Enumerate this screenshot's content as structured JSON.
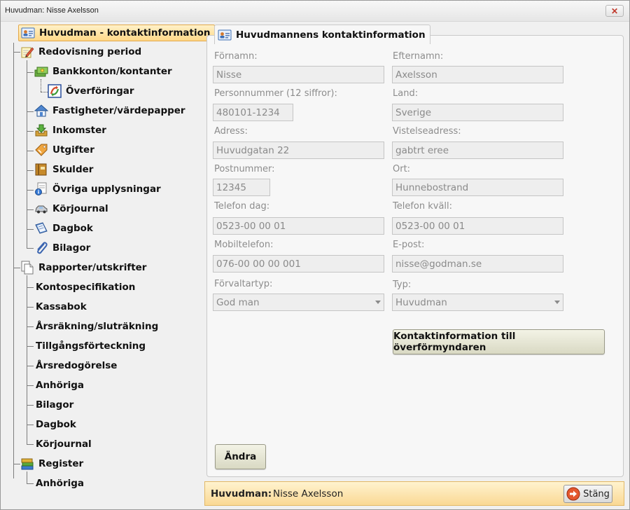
{
  "window": {
    "title": "Huvudman: Nisse Axelsson",
    "close_glyph": "✕"
  },
  "tree": {
    "main": "Huvudman - kontaktinformation",
    "period": "Redovisning period",
    "bank": "Bankkonton/kontanter",
    "transfers": "Överföringar",
    "property": "Fastigheter/värdepapper",
    "income": "Inkomster",
    "expenses": "Utgifter",
    "debts": "Skulder",
    "other_info": "Övriga upplysningar",
    "driving_log": "Körjournal",
    "diary": "Dagbok",
    "attachments": "Bilagor",
    "reports": "Rapporter/utskrifter",
    "reports_items": [
      "Kontospecifikation",
      "Kassabok",
      "Årsräkning/sluträkning",
      "Tillgångsförteckning",
      "Årsredogörelse",
      "Anhöriga",
      "Bilagor",
      "Dagbok",
      "Körjournal"
    ],
    "register": "Register",
    "register_items": [
      "Anhöriga"
    ]
  },
  "panel": {
    "title": "Huvudmannens kontaktinformation",
    "labels": {
      "first_name": "Förnamn:",
      "last_name": "Efternamn:",
      "ssn": "Personnummer (12 siffror):",
      "country": "Land:",
      "address": "Adress:",
      "stay_address": "Vistelseadress:",
      "postcode": "Postnummer:",
      "city": "Ort:",
      "phone_day": "Telefon dag:",
      "phone_evening": "Telefon kväll:",
      "mobile": "Mobiltelefon:",
      "email": "E-post:",
      "admin_type": "Förvaltartyp:",
      "type": "Typ:"
    },
    "values": {
      "first_name": "Nisse",
      "last_name": "Axelsson",
      "ssn": "480101-1234",
      "country": "Sverige",
      "address": "Huvudgatan 22",
      "stay_address": "gabtrt eree",
      "postcode": "12345",
      "city": "Hunnebostrand",
      "phone_day": "0523-00 00 01",
      "phone_evening": "0523-00 00 01",
      "mobile": "076-00 00 00 001",
      "email": "nisse@godman.se",
      "admin_type": "God man",
      "type": "Huvudman"
    },
    "contact_button": "Kontaktinformation till överförmyndaren",
    "edit_button": "Ändra"
  },
  "footer": {
    "key": "Huvudman:",
    "value": "Nisse Axelsson",
    "close_button": "Stäng"
  },
  "colors": {
    "selection": "#ffd888",
    "footer_bg": "#fad894",
    "field_bg": "#eeeeee",
    "close_x": "#c0392b"
  }
}
